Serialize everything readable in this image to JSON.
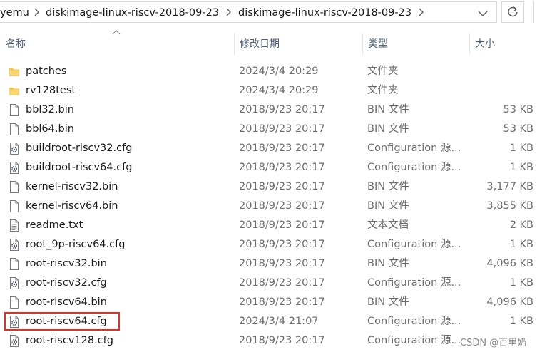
{
  "address_bar": {
    "crumbs": [
      "yemu",
      "diskimage-linux-riscv-2018-09-23",
      "diskimage-linux-riscv-2018-09-23"
    ]
  },
  "columns": {
    "name": "名称",
    "date": "修改日期",
    "type": "类型",
    "size": "大小"
  },
  "files": [
    {
      "name": "patches",
      "date": "2024/3/4 20:29",
      "type": "文件夹",
      "size": "",
      "icon": "folder-icon"
    },
    {
      "name": "rv128test",
      "date": "2024/3/4 20:29",
      "type": "文件夹",
      "size": "",
      "icon": "folder-icon"
    },
    {
      "name": "bbl32.bin",
      "date": "2018/9/23 20:17",
      "type": "BIN 文件",
      "size": "53 KB",
      "icon": "file-icon"
    },
    {
      "name": "bbl64.bin",
      "date": "2018/9/23 20:17",
      "type": "BIN 文件",
      "size": "53 KB",
      "icon": "file-icon"
    },
    {
      "name": "buildroot-riscv32.cfg",
      "date": "2018/9/23 20:17",
      "type": "Configuration 源...",
      "size": "1 KB",
      "icon": "config-file-icon"
    },
    {
      "name": "buildroot-riscv64.cfg",
      "date": "2018/9/23 20:17",
      "type": "Configuration 源...",
      "size": "1 KB",
      "icon": "config-file-icon"
    },
    {
      "name": "kernel-riscv32.bin",
      "date": "2018/9/23 20:17",
      "type": "BIN 文件",
      "size": "3,177 KB",
      "icon": "file-icon"
    },
    {
      "name": "kernel-riscv64.bin",
      "date": "2018/9/23 20:17",
      "type": "BIN 文件",
      "size": "3,855 KB",
      "icon": "file-icon"
    },
    {
      "name": "readme.txt",
      "date": "2018/9/23 20:17",
      "type": "文本文档",
      "size": "2 KB",
      "icon": "text-file-icon"
    },
    {
      "name": "root_9p-riscv64.cfg",
      "date": "2018/9/23 20:17",
      "type": "Configuration 源...",
      "size": "1 KB",
      "icon": "config-file-icon"
    },
    {
      "name": "root-riscv32.bin",
      "date": "2018/9/23 20:17",
      "type": "BIN 文件",
      "size": "4,096 KB",
      "icon": "file-icon"
    },
    {
      "name": "root-riscv32.cfg",
      "date": "2018/9/23 20:17",
      "type": "Configuration 源...",
      "size": "1 KB",
      "icon": "config-file-icon"
    },
    {
      "name": "root-riscv64.bin",
      "date": "2018/9/23 20:17",
      "type": "BIN 文件",
      "size": "4,096 KB",
      "icon": "file-icon"
    },
    {
      "name": "root-riscv64.cfg",
      "date": "2024/3/4 21:07",
      "type": "Configuration 源...",
      "size": "1 KB",
      "icon": "config-file-icon"
    },
    {
      "name": "root-riscv128.cfg",
      "date": "2018/9/23 20:17",
      "type": "Configuration 源...",
      "size": "",
      "icon": "config-file-icon"
    }
  ],
  "watermark": "CSDN @百里奶",
  "colors": {
    "folder": "#f4c34a",
    "highlight": "#d9342a",
    "header_text": "#4c607a"
  }
}
